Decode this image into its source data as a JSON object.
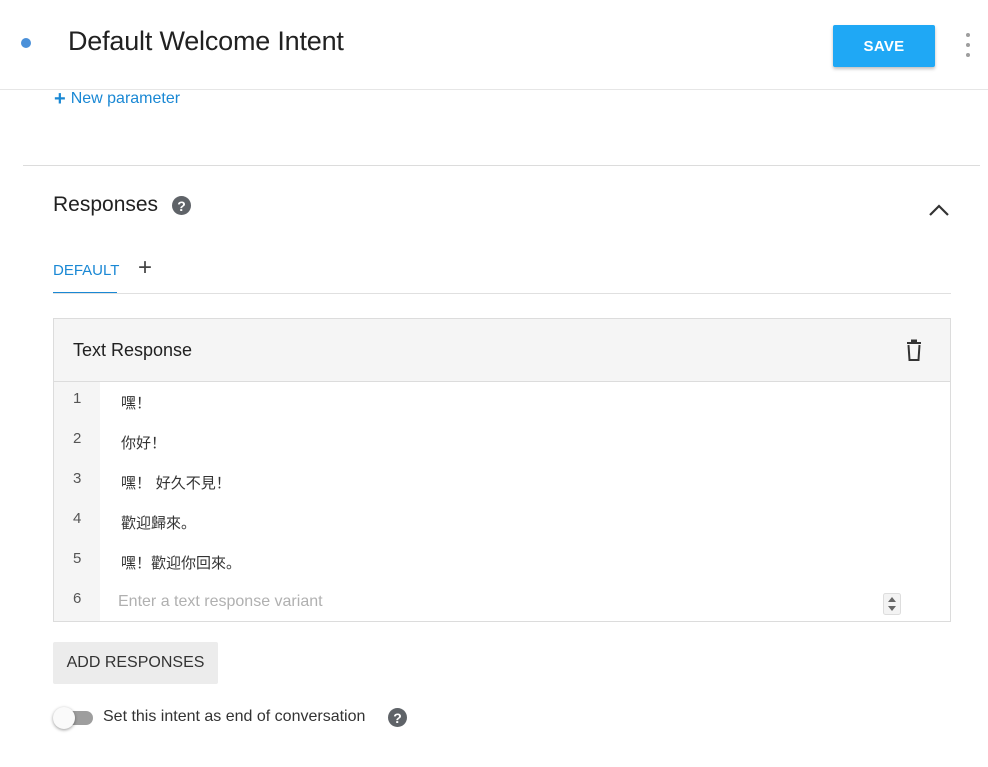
{
  "header": {
    "title": "Default Welcome Intent",
    "save_label": "SAVE",
    "accent_color": "#1fa8f5"
  },
  "parameters": {
    "new_parameter_label": "New parameter"
  },
  "responses": {
    "section_title": "Responses",
    "tabs": [
      {
        "label": "DEFAULT",
        "active": true
      }
    ],
    "card": {
      "title": "Text Response",
      "rows": [
        {
          "num": "1",
          "text": "嘿！"
        },
        {
          "num": "2",
          "text": "你好！"
        },
        {
          "num": "3",
          "text": "嘿！ 好久不見！"
        },
        {
          "num": "4",
          "text": "歡迎歸來。"
        },
        {
          "num": "5",
          "text": "嘿！歡迎你回來。"
        }
      ],
      "input_row": {
        "num": "6",
        "placeholder": "Enter a text response variant",
        "value": ""
      }
    },
    "add_responses_label": "ADD RESPONSES"
  },
  "end_conversation": {
    "label": "Set this intent as end of conversation",
    "enabled": false
  },
  "icons": {
    "help": "question-circle-icon",
    "collapse": "chevron-up-icon",
    "delete": "trash-icon",
    "more": "more-vert-icon"
  }
}
